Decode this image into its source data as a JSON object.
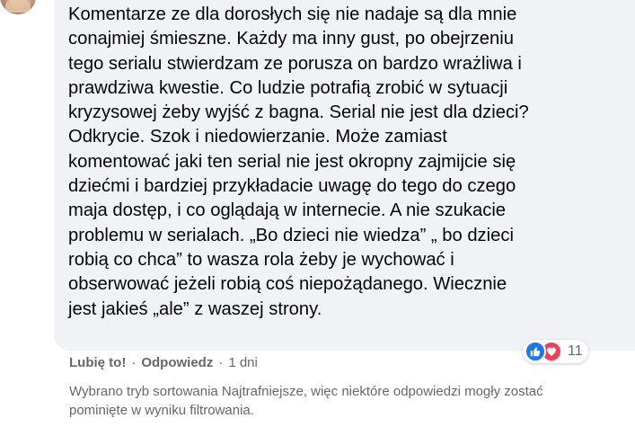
{
  "comment": {
    "text": "Komentarze ze dla dorosłych się nie nadaje są dla mnie\nconajmiej śmieszne. Każdy ma inny gust, po obejrzeniu\ntego serialu stwierdzam ze porusza on bardzo wrażliwa i\nprawdziwa kwestie. Co ludzie potrafią zrobić w sytuacji\nkryzysowej żeby wyjść z bagna. Serial nie jest dla dzieci?\nOdkrycie. Szok i niedowierzanie. Może zamiast\nkomentować jaki ten serial nie jest okropny zajmijcie się\ndziećmi i bardziej przykładacie uwagę do tego do czego\nmaja dostęp, i co oglądają w internecie. A nie szukacie\nproblemu w serialach. „Bo dzieci nie wiedza” „ bo dzieci\nrobią co chca” to wasza rola żeby je wychować i\nobserwować jeżeli robią coś niepożądanego. Wiecznie\njest jakieś „ale” z waszej strony."
  },
  "reactions": {
    "icons": [
      "like-icon",
      "love-icon"
    ],
    "count": "11",
    "colors": {
      "like": "#1877f2",
      "love": "#f33e58"
    }
  },
  "actions": {
    "like_label": "Lubię to!",
    "separator": "·",
    "reply_label": "Odpowiedz",
    "time": "1 dni"
  },
  "filter_note": "Wybrano tryb sortowania Najtrafniejsze, więc niektóre odpowiedzi mogły zostać\npominięte w wyniku filtrowania."
}
